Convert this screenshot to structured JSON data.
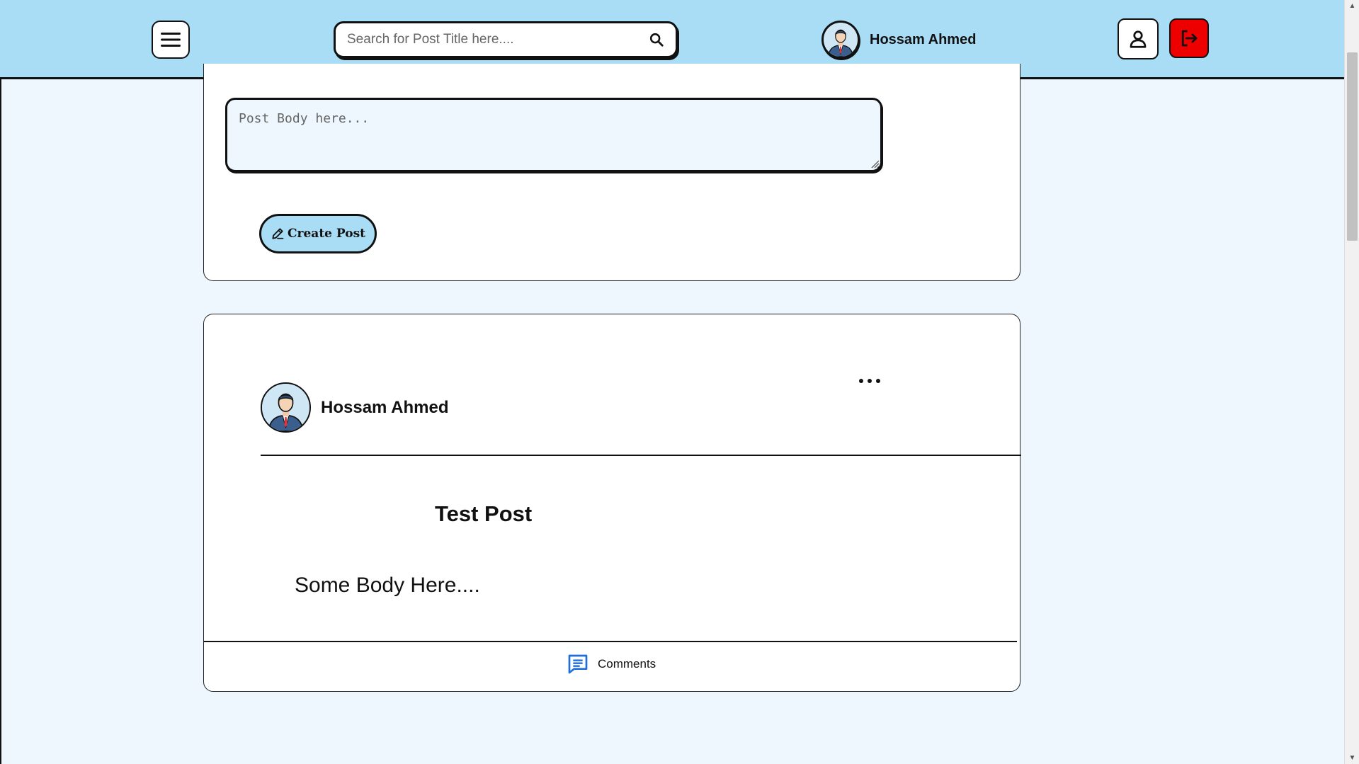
{
  "header": {
    "search": {
      "placeholder": "Search for Post Title here...."
    },
    "user": {
      "name": "Hossam Ahmed"
    }
  },
  "create_post": {
    "body_placeholder": "Post Body here...",
    "button_label": "Create Post"
  },
  "post": {
    "author": "Hossam Ahmed",
    "title": "Test Post",
    "body": "Some Body Here....",
    "comments_label": "Comments"
  },
  "colors": {
    "header_bg": "#a9dcf5",
    "page_bg": "#eef7fd",
    "logout_bg": "#ee0000",
    "accent_blue": "#1e6fd9"
  },
  "icons": {
    "menu": "hamburger-icon",
    "search": "search-icon",
    "profile": "user-icon",
    "logout": "logout-icon",
    "create": "edit-icon",
    "more": "ellipsis-icon",
    "comments": "comment-icon"
  }
}
